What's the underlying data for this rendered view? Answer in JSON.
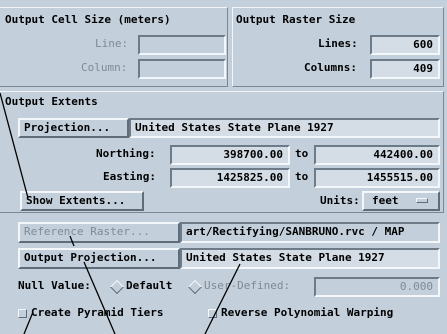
{
  "cell_size": {
    "title": "Output Cell Size (meters)",
    "line_label": "Line:",
    "column_label": "Column:",
    "line_value": "",
    "column_value": ""
  },
  "raster_size": {
    "title": "Output Raster Size",
    "lines_label": "Lines:",
    "lines_value": "600",
    "columns_label": "Columns:",
    "columns_value": "409"
  },
  "extents": {
    "title": "Output Extents",
    "projection_button": "Projection...",
    "projection_value": "United States State Plane 1927",
    "northing_label": "Northing:",
    "northing_from": "398700.00",
    "northing_to": "442400.00",
    "easting_label": "Easting:",
    "easting_from": "1425825.00",
    "easting_to": "1455515.00",
    "to_label": "to",
    "show_extents_button": "Show Extents...",
    "units_label": "Units:",
    "units_value": "feet"
  },
  "reference": {
    "button": "Reference Raster...",
    "path": "art/Rectifying/SANBRUNO.rvc / MAP"
  },
  "output_projection": {
    "button": "Output Projection...",
    "value": "United States State Plane 1927"
  },
  "null_value": {
    "label": "Null Value:",
    "default_label": "Default",
    "user_defined_label": "User-Defined:",
    "user_defined_value": "0.000"
  },
  "options": {
    "pyramid_label": "Create Pyramid Tiers",
    "reverse_label": "Reverse Polynomial Warping"
  },
  "colors": {
    "background": "#c3cfdb",
    "field": "#d4dde6",
    "callout_line": "#000000"
  }
}
